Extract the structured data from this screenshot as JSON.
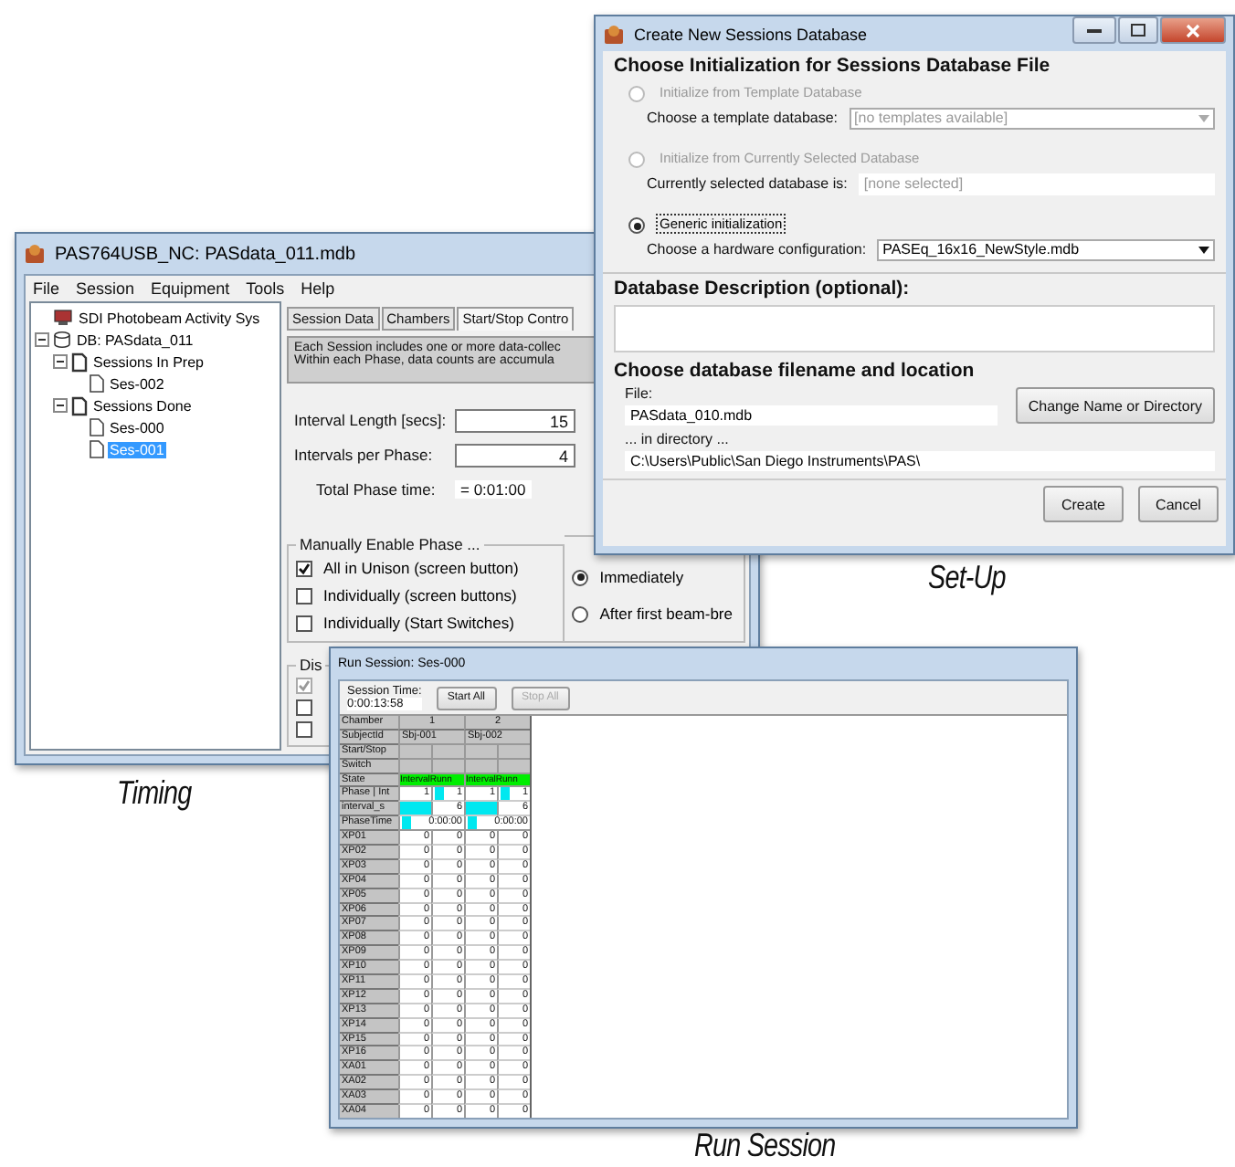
{
  "timing_window": {
    "title": "PAS764USB_NC: PASdata_011.mdb",
    "menu": [
      "File",
      "Session",
      "Equipment",
      "Tools",
      "Help"
    ],
    "tree": [
      {
        "label": "SDI Photobeam Activity Sys",
        "kind": "system",
        "selected": false
      },
      {
        "label": "DB: PASdata_011",
        "kind": "database",
        "selected": false,
        "expanded": true,
        "children": [
          {
            "label": "Sessions In Prep",
            "kind": "group",
            "selected": false,
            "expanded": true,
            "children": [
              {
                "label": "Ses-002",
                "kind": "session",
                "selected": false
              }
            ]
          },
          {
            "label": "Sessions Done",
            "kind": "group",
            "selected": false,
            "expanded": true,
            "children": [
              {
                "label": "Ses-000",
                "kind": "session",
                "selected": false
              },
              {
                "label": "Ses-001",
                "kind": "session",
                "selected": true
              }
            ]
          }
        ]
      }
    ],
    "tabs": [
      {
        "label": "Session Data",
        "selected": false
      },
      {
        "label": "Chambers",
        "selected": false
      },
      {
        "label": "Start/Stop Contro",
        "selected": true
      }
    ],
    "description": [
      "Each Session includes one or more data-collec",
      "Within each Phase, data counts are accumula"
    ],
    "fields": [
      {
        "label": "Interval Length [secs]:",
        "value": "15"
      },
      {
        "label": "Intervals per Phase:",
        "value": "4"
      }
    ],
    "total": {
      "label": "Total Phase time:",
      "value": "= 0:01:00"
    },
    "manual_group": {
      "title": "Manually Enable Phase ...",
      "options": [
        {
          "label": "All in Unison (screen button)",
          "checked": true
        },
        {
          "label": "Individually (screen buttons)",
          "checked": false
        },
        {
          "label": "Individually (Start Switches)",
          "checked": false
        }
      ]
    },
    "start_options": [
      {
        "label": "Immediately",
        "selected": true
      },
      {
        "label": "After first beam-bre",
        "selected": false
      }
    ],
    "display_group": {
      "title": "Dis",
      "options": [
        {
          "checked": true,
          "disabled": true
        },
        {
          "checked": false,
          "disabled": false
        },
        {
          "checked": false,
          "disabled": false
        }
      ]
    },
    "caption": "Timing"
  },
  "setup_window": {
    "title": "Create New Sessions Database",
    "init_section": {
      "title": "Choose Initialization for Sessions Database File",
      "options": [
        {
          "label": "Initialize from Template Database",
          "selected": false,
          "disabled": true,
          "field_label": "Choose a template database:",
          "field_value": "[no templates available]",
          "kind": "dropdown"
        },
        {
          "label": "Initialize from Currently Selected Database",
          "selected": false,
          "disabled": true,
          "field_label": "Currently selected database is:",
          "field_value": "[none selected]",
          "kind": "text"
        },
        {
          "label": "Generic initialization",
          "selected": true,
          "disabled": false,
          "field_label": "Choose a hardware configuration:",
          "field_value": "PASEq_16x16_NewStyle.mdb",
          "kind": "dropdown"
        }
      ]
    },
    "description_section": {
      "title": "Database Description (optional):"
    },
    "file_section": {
      "title": "Choose database filename and location",
      "file_label": "File:",
      "file_value": "PASdata_010.mdb",
      "change_button": "Change Name or Directory",
      "directory_label": "... in directory ...",
      "directory_value": "C:\\Users\\Public\\San Diego Instruments\\PAS\\"
    },
    "buttons": [
      "Create",
      "Cancel"
    ],
    "caption": "Set-Up"
  },
  "run_window": {
    "title": "Run Session: Ses-000",
    "session_time_label": "Session Time:",
    "session_time": "0:00:13:58",
    "buttons": [
      {
        "label": "Start All",
        "disabled": false
      },
      {
        "label": "Stop All",
        "disabled": true
      }
    ],
    "rows": [
      {
        "label": "Chamber",
        "kind": "header",
        "cells": [
          {
            "text": "1"
          },
          {
            "text": "2"
          }
        ]
      },
      {
        "label": "SubjectId",
        "kind": "span",
        "cells": [
          {
            "text": "Sbj-001"
          },
          {
            "text": "Sbj-002"
          }
        ]
      },
      {
        "label": "Start/Stop",
        "kind": "blank"
      },
      {
        "label": "Switch",
        "kind": "blank"
      },
      {
        "label": "State",
        "kind": "state",
        "cells": [
          {
            "text": "IntervalRunn",
            "color": "#00ee00"
          },
          {
            "text": "IntervalRunn",
            "color": "#00ee00"
          }
        ]
      },
      {
        "label": "Phase | Int",
        "kind": "split",
        "cells": [
          {
            "text": "1"
          },
          {
            "text": "1",
            "color": "#00e8f0"
          },
          {
            "text": "1"
          },
          {
            "text": "1",
            "color": "#00e8f0"
          }
        ]
      },
      {
        "label": "interval_s",
        "kind": "split",
        "cells": [
          {
            "color": "#00e8f0"
          },
          {
            "text": "6"
          },
          {
            "color": "#00e8f0"
          },
          {
            "text": "6"
          }
        ]
      },
      {
        "label": "PhaseTime",
        "kind": "span",
        "cells": [
          {
            "text": "0:00:00",
            "color": "#00e8f0"
          },
          {
            "text": "0:00:00",
            "color": "#00e8f0"
          }
        ]
      },
      {
        "label": "XP01",
        "kind": "split",
        "cells": [
          {
            "text": "0"
          },
          {
            "text": "0"
          },
          {
            "text": "0"
          },
          {
            "text": "0"
          }
        ]
      },
      {
        "label": "XP02",
        "kind": "split",
        "cells": [
          {
            "text": "0"
          },
          {
            "text": "0"
          },
          {
            "text": "0"
          },
          {
            "text": "0"
          }
        ]
      },
      {
        "label": "XP03",
        "kind": "split",
        "cells": [
          {
            "text": "0"
          },
          {
            "text": "0"
          },
          {
            "text": "0"
          },
          {
            "text": "0"
          }
        ]
      },
      {
        "label": "XP04",
        "kind": "split",
        "cells": [
          {
            "text": "0"
          },
          {
            "text": "0"
          },
          {
            "text": "0"
          },
          {
            "text": "0"
          }
        ]
      },
      {
        "label": "XP05",
        "kind": "split",
        "cells": [
          {
            "text": "0"
          },
          {
            "text": "0"
          },
          {
            "text": "0"
          },
          {
            "text": "0"
          }
        ]
      },
      {
        "label": "XP06",
        "kind": "split",
        "cells": [
          {
            "text": "0"
          },
          {
            "text": "0"
          },
          {
            "text": "0"
          },
          {
            "text": "0"
          }
        ]
      },
      {
        "label": "XP07",
        "kind": "split",
        "cells": [
          {
            "text": "0"
          },
          {
            "text": "0"
          },
          {
            "text": "0"
          },
          {
            "text": "0"
          }
        ]
      },
      {
        "label": "XP08",
        "kind": "split",
        "cells": [
          {
            "text": "0"
          },
          {
            "text": "0"
          },
          {
            "text": "0"
          },
          {
            "text": "0"
          }
        ]
      },
      {
        "label": "XP09",
        "kind": "split",
        "cells": [
          {
            "text": "0"
          },
          {
            "text": "0"
          },
          {
            "text": "0"
          },
          {
            "text": "0"
          }
        ]
      },
      {
        "label": "XP10",
        "kind": "split",
        "cells": [
          {
            "text": "0"
          },
          {
            "text": "0"
          },
          {
            "text": "0"
          },
          {
            "text": "0"
          }
        ]
      },
      {
        "label": "XP11",
        "kind": "split",
        "cells": [
          {
            "text": "0"
          },
          {
            "text": "0"
          },
          {
            "text": "0"
          },
          {
            "text": "0"
          }
        ]
      },
      {
        "label": "XP12",
        "kind": "split",
        "cells": [
          {
            "text": "0"
          },
          {
            "text": "0"
          },
          {
            "text": "0"
          },
          {
            "text": "0"
          }
        ]
      },
      {
        "label": "XP13",
        "kind": "split",
        "cells": [
          {
            "text": "0"
          },
          {
            "text": "0"
          },
          {
            "text": "0"
          },
          {
            "text": "0"
          }
        ]
      },
      {
        "label": "XP14",
        "kind": "split",
        "cells": [
          {
            "text": "0"
          },
          {
            "text": "0"
          },
          {
            "text": "0"
          },
          {
            "text": "0"
          }
        ]
      },
      {
        "label": "XP15",
        "kind": "split",
        "cells": [
          {
            "text": "0"
          },
          {
            "text": "0"
          },
          {
            "text": "0"
          },
          {
            "text": "0"
          }
        ]
      },
      {
        "label": "XP16",
        "kind": "split",
        "cells": [
          {
            "text": "0"
          },
          {
            "text": "0"
          },
          {
            "text": "0"
          },
          {
            "text": "0"
          }
        ]
      },
      {
        "label": "XA01",
        "kind": "split",
        "cells": [
          {
            "text": "0"
          },
          {
            "text": "0"
          },
          {
            "text": "0"
          },
          {
            "text": "0"
          }
        ]
      },
      {
        "label": "XA02",
        "kind": "split",
        "cells": [
          {
            "text": "0"
          },
          {
            "text": "0"
          },
          {
            "text": "0"
          },
          {
            "text": "0"
          }
        ]
      },
      {
        "label": "XA03",
        "kind": "split",
        "cells": [
          {
            "text": "0"
          },
          {
            "text": "0"
          },
          {
            "text": "0"
          },
          {
            "text": "0"
          }
        ]
      },
      {
        "label": "XA04",
        "kind": "split",
        "cells": [
          {
            "text": "0"
          },
          {
            "text": "0"
          },
          {
            "text": "0"
          },
          {
            "text": "0"
          }
        ]
      }
    ],
    "caption": "Run Session"
  }
}
